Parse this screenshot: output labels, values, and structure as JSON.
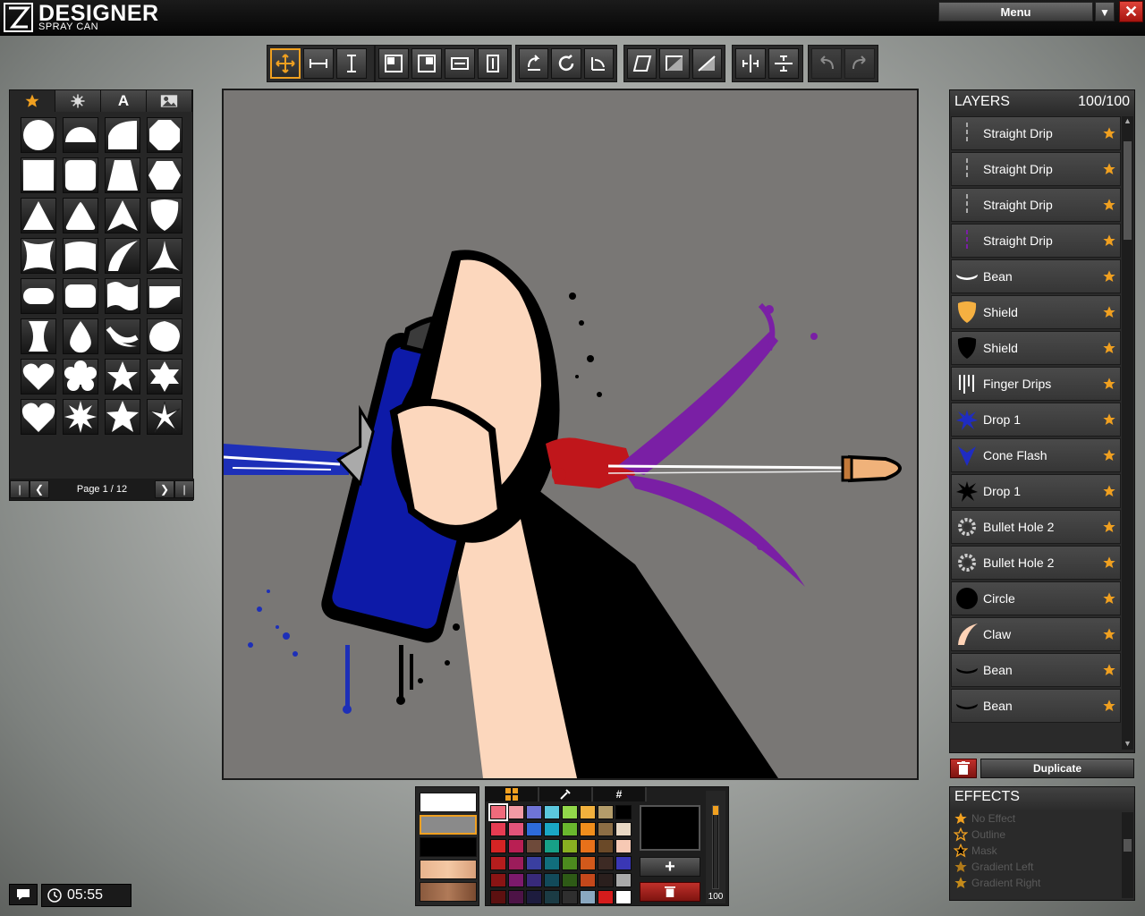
{
  "app": {
    "title": "DESIGNER",
    "subtitle": "SPRAY CAN"
  },
  "window": {
    "menu_label": "Menu"
  },
  "toolbar": {
    "groups": [
      [
        "move-icon",
        "scale-horizontal-icon",
        "scale-vertical-icon"
      ],
      [
        "align-top-left-icon",
        "align-top-right-icon",
        "stretch-horizontal-icon",
        "stretch-vertical-icon"
      ],
      [
        "rotate-left-icon",
        "rotate-free-icon",
        "rotate-right-icon"
      ],
      [
        "skew-icon",
        "flip-horizontal-icon",
        "flip-vertical-icon"
      ],
      [
        "center-horizontal-icon",
        "center-vertical-icon"
      ],
      [
        "undo-icon",
        "redo-icon"
      ]
    ],
    "active": "move-icon"
  },
  "shapes_panel": {
    "tabs": [
      "star-icon",
      "splat-icon",
      "A",
      "image-icon"
    ],
    "active_tab": 0,
    "page_label": "Page 1 / 12",
    "shapes": [
      "circle",
      "half-circle",
      "quarter-circle",
      "octagon",
      "square",
      "rounded-square",
      "trapezoid",
      "hexagon",
      "triangle",
      "rounded-triangle",
      "arrow-triangle",
      "shield",
      "concave-square",
      "arched-rect",
      "claw",
      "concave-triangle",
      "pill",
      "rounded-rect",
      "wave-flag",
      "wave-rect",
      "hourglass",
      "drop",
      "crescent",
      "blob",
      "heart",
      "flower",
      "star",
      "hexagram",
      "heart-bold",
      "starburst",
      "star-bold",
      "swirl-star"
    ]
  },
  "layers": {
    "title": "LAYERS",
    "count": "100/100",
    "items": [
      {
        "label": "Straight Drip",
        "thumb": "drip-thin-icon",
        "color": "#aaaaaa"
      },
      {
        "label": "Straight Drip",
        "thumb": "drip-thin-icon",
        "color": "#aaaaaa"
      },
      {
        "label": "Straight Drip",
        "thumb": "drip-thin-icon",
        "color": "#aaaaaa"
      },
      {
        "label": "Straight Drip",
        "thumb": "drip-thin-icon",
        "color": "#7a1fa5"
      },
      {
        "label": "Bean",
        "thumb": "bean-icon",
        "color": "#ffffff"
      },
      {
        "label": "Shield",
        "thumb": "shield-icon",
        "color": "#f5b041"
      },
      {
        "label": "Shield",
        "thumb": "shield-icon",
        "color": "#000000"
      },
      {
        "label": "Finger Drips",
        "thumb": "finger-drips-icon",
        "color": "#ffffff"
      },
      {
        "label": "Drop 1",
        "thumb": "splat-icon",
        "color": "#1f2cc2"
      },
      {
        "label": "Cone Flash",
        "thumb": "cone-flash-icon",
        "color": "#1f2cc2"
      },
      {
        "label": "Drop 1",
        "thumb": "splat-icon",
        "color": "#000000"
      },
      {
        "label": "Bullet Hole 2",
        "thumb": "gear-icon",
        "color": "#333333"
      },
      {
        "label": "Bullet Hole 2",
        "thumb": "gear-icon",
        "color": "#333333"
      },
      {
        "label": "Circle",
        "thumb": "circle-icon",
        "color": "#000000"
      },
      {
        "label": "Claw",
        "thumb": "claw-icon",
        "color": "#ffd3b6"
      },
      {
        "label": "Bean",
        "thumb": "bean-icon",
        "color": "#000000"
      },
      {
        "label": "Bean",
        "thumb": "bean-icon",
        "color": "#000000"
      }
    ],
    "duplicate_label": "Duplicate"
  },
  "effects": {
    "title": "EFFECTS",
    "items": [
      "No Effect",
      "Outline",
      "Mask",
      "Gradient Left",
      "Gradient Right"
    ]
  },
  "fill_swatches": [
    "#ffffff",
    "#8a8a8a",
    "#000000",
    "skin-light",
    "skin-dark"
  ],
  "palette": {
    "tabs": [
      "grid-icon",
      "eyedropper-icon",
      "#"
    ],
    "colors": [
      "#f06b7c",
      "#f29aa4",
      "#6f74d6",
      "#5bc7dd",
      "#92d84a",
      "#f2b13d",
      "#b39c6a",
      "#000000",
      "#e63c52",
      "#e2547a",
      "#2d6bd9",
      "#1aa7c4",
      "#6ab72e",
      "#f08e1c",
      "#8c6e45",
      "#e8d8c4",
      "#d52424",
      "#b91f53",
      "#6e4a3a",
      "#17a187",
      "#89b021",
      "#e8711a",
      "#6a4928",
      "#f7c9b4",
      "#b51d1d",
      "#9c1c5b",
      "#3a3fa0",
      "#116e7c",
      "#4c8a1e",
      "#d2591b",
      "#3d2a24",
      "#3a37b5",
      "#8a1414",
      "#7c1a6c",
      "#382a7a",
      "#124a5a",
      "#2e5a16",
      "#c4481b",
      "#2a1f1d",
      "#aaaaaa",
      "#5c1010",
      "#4d1346",
      "#1d1c3e",
      "#1b3b44",
      "#2f2f2f",
      "#8aa8c0",
      "#d51c1c",
      "#ffffff"
    ],
    "selected_color": "#000000",
    "opacity_value": 100
  },
  "status": {
    "timer": "05:55"
  }
}
